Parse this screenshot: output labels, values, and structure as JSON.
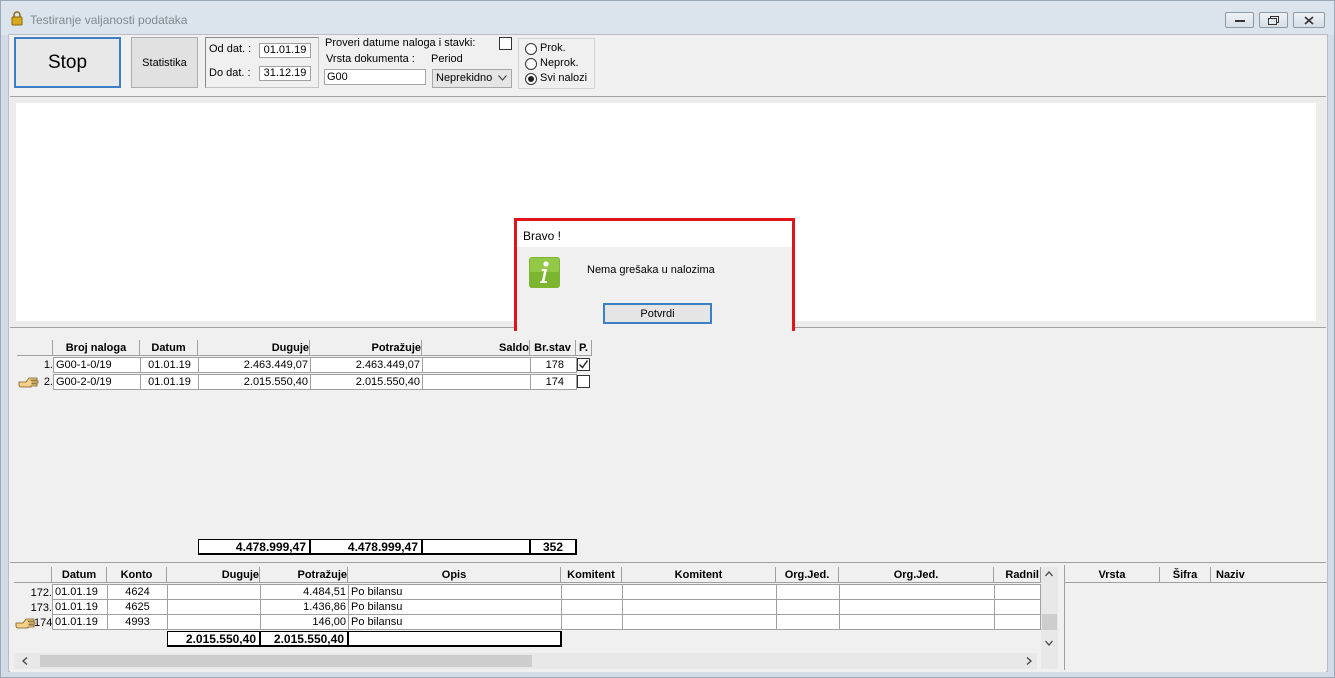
{
  "window": {
    "title": "Testiranje valjanosti podataka"
  },
  "toolbar": {
    "stop_label": "Stop",
    "stat_label": "Statistika",
    "od_dat_label": "Od dat. :",
    "od_dat_value": "01.01.19",
    "do_dat_label": "Do dat. :",
    "do_dat_value": "31.12.19",
    "proveri_label": "Proveri datume naloga i stavki:",
    "vrsta_label": "Vrsta dokumenta :",
    "vrsta_value": "G00",
    "period_label": "Period",
    "period_value": "Neprekidno",
    "radio_prok": "Prok.",
    "radio_neprok": "Neprok.",
    "radio_svi": "Svi nalozi",
    "selected_radio": "Svi nalozi"
  },
  "dialog": {
    "title": "Bravo !",
    "message": "Nema grešaka u nalozima",
    "ok_label": "Potvrdi",
    "highlight_color": "#e1141c"
  },
  "nalozi_grid": {
    "headers": [
      "Broj naloga",
      "Datum",
      "Duguje",
      "Potražuje",
      "Saldo",
      "Br.stav",
      "P."
    ],
    "rows": [
      {
        "num": "1.",
        "broj": "G00-1-0/19",
        "datum": "01.01.19",
        "duguje": "2.463.449,07",
        "potrazuje": "2.463.449,07",
        "saldo": "",
        "brstav": "178",
        "checked": true
      },
      {
        "num": "2.",
        "broj": "G00-2-0/19",
        "datum": "01.01.19",
        "duguje": "2.015.550,40",
        "potrazuje": "2.015.550,40",
        "saldo": "",
        "brstav": "174",
        "checked": false
      }
    ],
    "totals": {
      "duguje": "4.478.999,47",
      "potrazuje": "4.478.999,47",
      "saldo": "",
      "brstav": "352"
    }
  },
  "stavke_grid": {
    "headers": [
      "Datum",
      "Konto",
      "Duguje",
      "Potražuje",
      "Opis",
      "Komitent",
      "Komitent",
      "Org.Jed.",
      "Org.Jed.",
      "Radnil"
    ],
    "rows": [
      {
        "num": "172.",
        "datum": "01.01.19",
        "konto": "4624",
        "duguje": "",
        "potrazuje": "4.484,51",
        "opis": "Po bilansu"
      },
      {
        "num": "173.",
        "datum": "01.01.19",
        "konto": "4625",
        "duguje": "",
        "potrazuje": "1.436,86",
        "opis": "Po bilansu"
      },
      {
        "num": "174.",
        "datum": "01.01.19",
        "konto": "4993",
        "duguje": "",
        "potrazuje": "146,00",
        "opis": "Po bilansu"
      }
    ],
    "totals": {
      "duguje": "2.015.550,40",
      "potrazuje": "2.015.550,40",
      "opis": ""
    }
  },
  "side_grid": {
    "headers": [
      "Vrsta",
      "Šifra",
      "Naziv"
    ]
  }
}
